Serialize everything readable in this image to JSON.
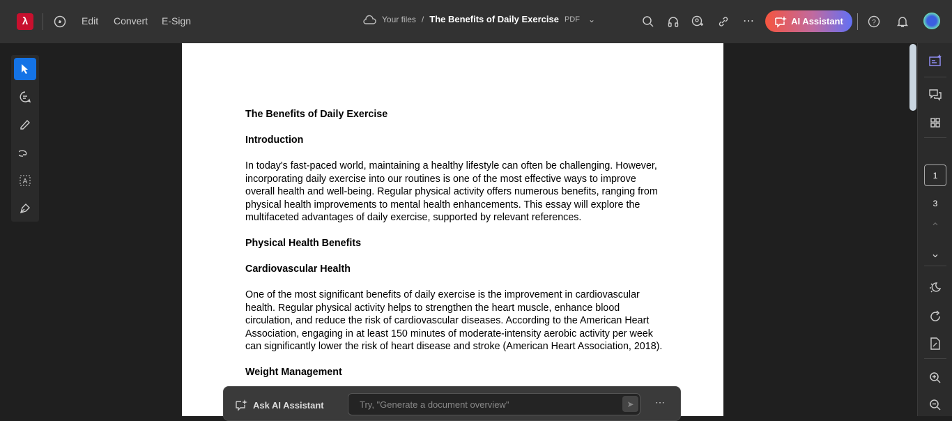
{
  "topbar": {
    "menu": [
      "Edit",
      "Convert",
      "E-Sign"
    ],
    "breadcrumb": {
      "location": "Your files",
      "separator": "/",
      "title": "The Benefits of Daily Exercise",
      "type": "PDF"
    },
    "ai_button": "AI Assistant"
  },
  "document": {
    "blocks": [
      {
        "kind": "h",
        "text": "The Benefits of Daily Exercise"
      },
      {
        "kind": "h",
        "text": "Introduction"
      },
      {
        "kind": "p",
        "text": "In today's fast-paced world, maintaining a healthy lifestyle can often be challenging. However, incorporating daily exercise into our routines is one of the most effective ways to improve overall health and well-being. Regular physical activity offers numerous benefits, ranging from physical health improvements to mental health enhancements. This essay will explore the multifaceted advantages of daily exercise, supported by relevant references."
      },
      {
        "kind": "h",
        "text": "Physical Health Benefits"
      },
      {
        "kind": "h",
        "text": "Cardiovascular Health"
      },
      {
        "kind": "p",
        "text": "One of the most significant benefits of daily exercise is the improvement in cardiovascular health. Regular physical activity helps to strengthen the heart muscle, enhance blood circulation, and reduce the risk of cardiovascular diseases. According to the American Heart Association, engaging in at least 150 minutes of moderate-intensity aerobic activity per week can significantly lower the risk of heart disease and stroke (American Heart Association, 2018)."
      },
      {
        "kind": "h",
        "text": "Weight Management"
      }
    ]
  },
  "pagination": {
    "current": "1",
    "total": "3"
  },
  "ai_bar": {
    "label": "Ask AI Assistant",
    "placeholder": "Try, \"Generate a document overview\""
  },
  "colors": {
    "accent": "#1473e6",
    "topbar": "#323232",
    "background": "#1f1f1f"
  }
}
